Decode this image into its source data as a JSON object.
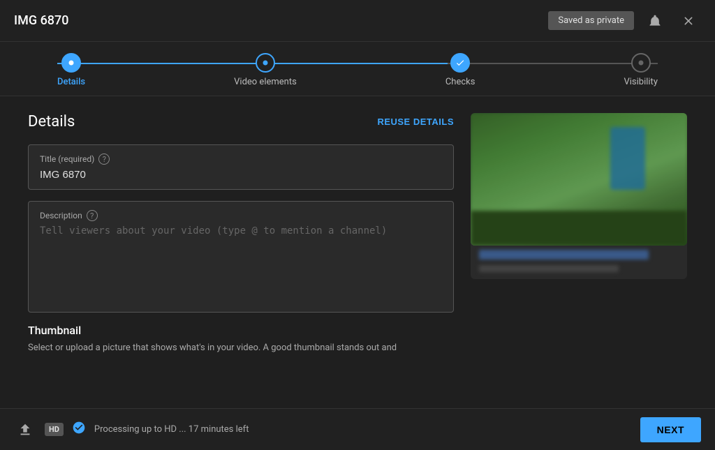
{
  "header": {
    "title": "IMG 6870",
    "saved_badge": "Saved as private",
    "alert_icon": "⚑",
    "close_icon": "✕"
  },
  "steps": [
    {
      "label": "Details",
      "state": "active"
    },
    {
      "label": "Video elements",
      "state": "normal"
    },
    {
      "label": "Checks",
      "state": "done"
    },
    {
      "label": "Visibility",
      "state": "inactive"
    }
  ],
  "details": {
    "section_title": "Details",
    "reuse_label": "REUSE DETAILS",
    "title_label": "Title (required)",
    "title_value": "IMG 6870",
    "description_label": "Description",
    "description_placeholder": "Tell viewers about your video (type @ to mention a channel)",
    "thumbnail_title": "Thumbnail",
    "thumbnail_desc": "Select or upload a picture that shows what's in your video. A good thumbnail stands out and"
  },
  "footer": {
    "processing_text": "Processing up to HD ... 17 minutes left",
    "hd_label": "HD",
    "next_label": "NEXT"
  }
}
